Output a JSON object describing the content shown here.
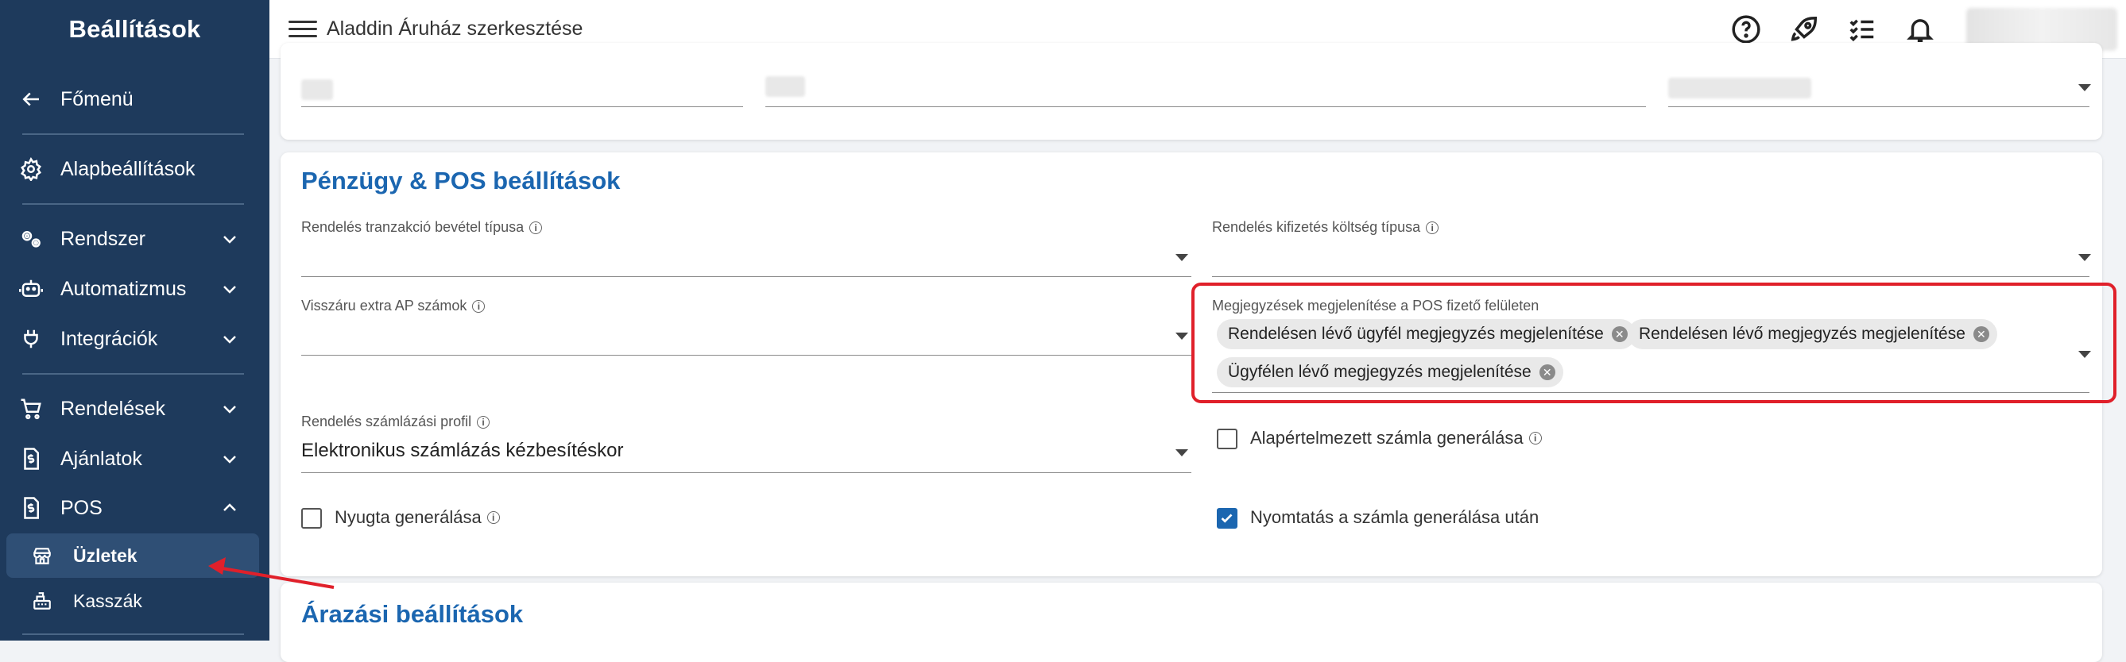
{
  "sidebar": {
    "title": "Beállítások",
    "items": [
      {
        "label": "Főmenü",
        "icon": "arrow-left-icon"
      },
      {
        "label": "Alapbeállítások",
        "icon": "gear-icon"
      },
      {
        "label": "Rendszer",
        "icon": "gears-icon"
      },
      {
        "label": "Automatizmus",
        "icon": "robot-icon"
      },
      {
        "label": "Integrációk",
        "icon": "plug-icon"
      },
      {
        "label": "Rendelések",
        "icon": "cart-icon"
      },
      {
        "label": "Ajánlatok",
        "icon": "document-dollar-icon"
      },
      {
        "label": "POS",
        "icon": "document-dollar-icon"
      }
    ],
    "pos_sub_items": [
      {
        "label": "Üzletek",
        "icon": "store-icon",
        "active": true
      },
      {
        "label": "Kasszák",
        "icon": "cash-register-icon",
        "active": false
      }
    ]
  },
  "topbar": {
    "title": "Aladdin Áruház szerkesztése",
    "icons": [
      "help-icon",
      "rocket-icon",
      "checklist-icon",
      "bell-icon"
    ]
  },
  "finance_section": {
    "title": "Pénzügy & POS beállítások",
    "order_transaction_income_type": {
      "label": "Rendelés tranzakció bevétel típusa",
      "value": ""
    },
    "order_payment_cost_type": {
      "label": "Rendelés kifizetés költség típusa",
      "value": ""
    },
    "return_extra_ap_numbers": {
      "label": "Visszáru extra AP számok",
      "value": ""
    },
    "pos_notes_display": {
      "label": "Megjegyzések megjelenítése a POS fizető felületen",
      "chips": [
        "Rendelésen lévő ügyfél megjegyzés megjelenítése",
        "Rendelésen lévő megjegyzés megjelenítése",
        "Ügyfélen lévő megjegyzés megjelenítése"
      ]
    },
    "order_invoice_profile": {
      "label": "Rendelés számlázási profil",
      "value": "Elektronikus számlázás kézbesítéskor"
    },
    "default_invoice_generation": {
      "label": "Alapértelmezett számla generálása",
      "checked": false
    },
    "receipt_generation": {
      "label": "Nyugta generálása",
      "checked": false
    },
    "print_after_invoice": {
      "label": "Nyomtatás a számla generálása után",
      "checked": true
    }
  },
  "pricing_section": {
    "title": "Árazási beállítások"
  },
  "colors": {
    "sidebar_bg": "#1e3a5c",
    "accent_blue": "#1b66b0",
    "highlight_red": "#e0202a"
  }
}
